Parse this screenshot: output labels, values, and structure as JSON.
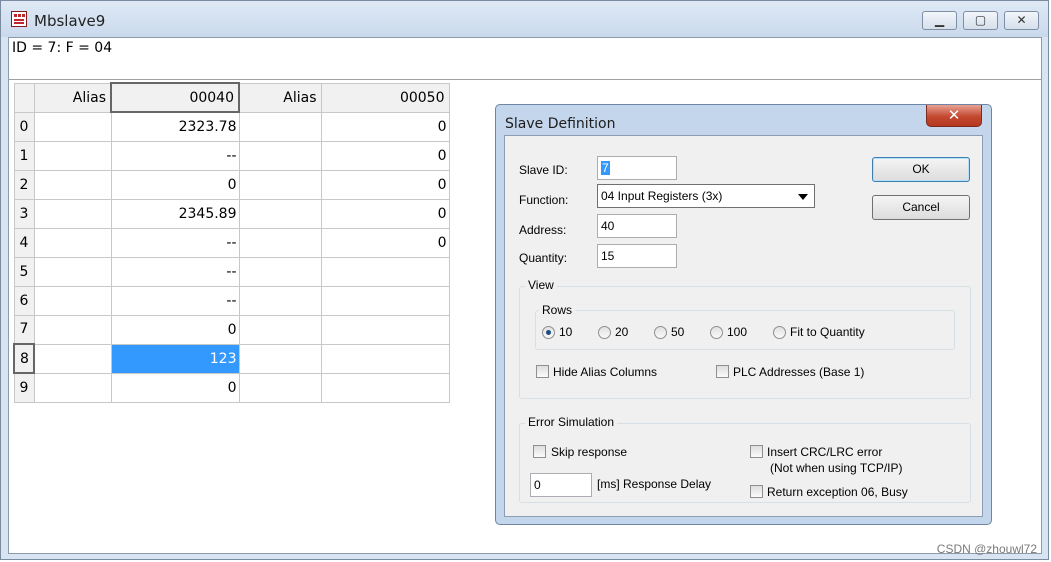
{
  "window": {
    "title": "Mbslave9",
    "minimize": "▁",
    "maximize": "▢",
    "close": "✕"
  },
  "header": {
    "text": "ID = 7: F = 04"
  },
  "grid": {
    "columns": [
      "Alias",
      "00040",
      "Alias",
      "00050"
    ],
    "rows": [
      {
        "index": "0",
        "a1": "",
        "v1": "2323.78",
        "a2": "",
        "v2": "0"
      },
      {
        "index": "1",
        "a1": "",
        "v1": "--",
        "a2": "",
        "v2": "0"
      },
      {
        "index": "2",
        "a1": "",
        "v1": "0",
        "a2": "",
        "v2": "0"
      },
      {
        "index": "3",
        "a1": "",
        "v1": "2345.89",
        "a2": "",
        "v2": "0"
      },
      {
        "index": "4",
        "a1": "",
        "v1": "--",
        "a2": "",
        "v2": "0"
      },
      {
        "index": "5",
        "a1": "",
        "v1": "--",
        "a2": "",
        "v2": ""
      },
      {
        "index": "6",
        "a1": "",
        "v1": "--",
        "a2": "",
        "v2": ""
      },
      {
        "index": "7",
        "a1": "",
        "v1": "0",
        "a2": "",
        "v2": ""
      },
      {
        "index": "8",
        "a1": "",
        "v1": "123",
        "a2": "",
        "v2": ""
      },
      {
        "index": "9",
        "a1": "",
        "v1": "0",
        "a2": "",
        "v2": ""
      }
    ]
  },
  "dialog": {
    "title": "Slave Definition",
    "close": "✕",
    "slave_id_label": "Slave ID:",
    "slave_id_value": "7",
    "function_label": "Function:",
    "function_value": "04 Input Registers (3x)",
    "address_label": "Address:",
    "address_value": "40",
    "quantity_label": "Quantity:",
    "quantity_value": "15",
    "ok": "OK",
    "cancel": "Cancel",
    "view": {
      "title": "View",
      "rows_title": "Rows",
      "rows_options": [
        "10",
        "20",
        "50",
        "100",
        "Fit to Quantity"
      ],
      "rows_selected": "10",
      "hide_alias": "Hide Alias Columns",
      "plc_addresses": "PLC Addresses (Base 1)"
    },
    "error_sim": {
      "title": "Error Simulation",
      "skip_response": "Skip response",
      "insert_crc": "Insert CRC/LRC error",
      "insert_crc_note": "(Not when using TCP/IP)",
      "delay_value": "0",
      "delay_label": "[ms] Response Delay",
      "return_exception": "Return exception 06, Busy"
    }
  },
  "watermark": "CSDN @zhouwl72",
  "colors": {
    "selection": "#3399ff",
    "highlight_box": "#e62020"
  }
}
